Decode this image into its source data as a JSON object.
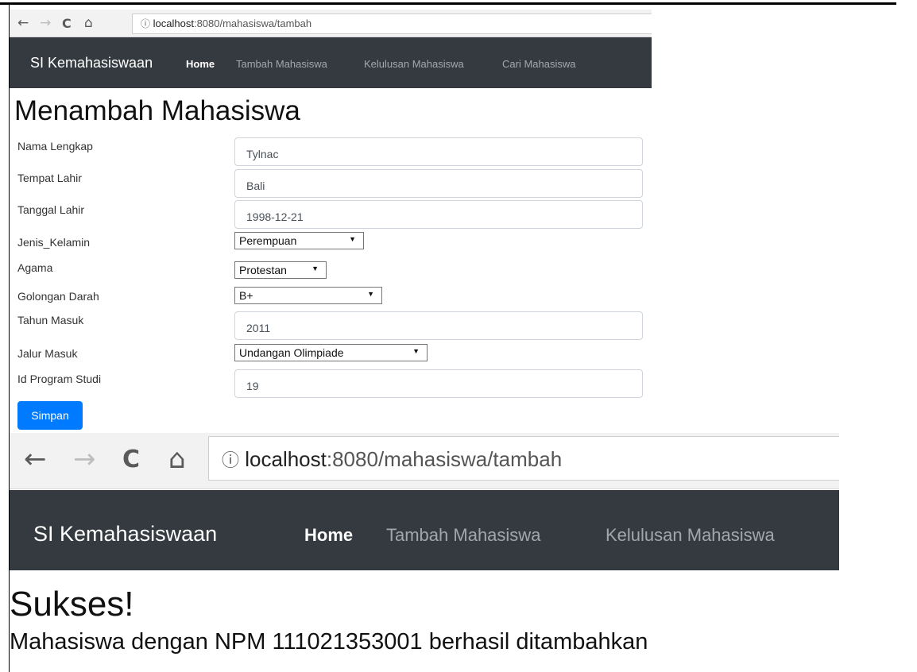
{
  "screen1": {
    "address": {
      "host": "localhost",
      "path": ":8080/mahasiswa/tambah"
    },
    "navbar": {
      "brand": "SI Kemahasiswaan",
      "links": [
        {
          "label": "Home",
          "active": true
        },
        {
          "label": "Tambah Mahasiswa",
          "active": false
        },
        {
          "label": "Kelulusan Mahasiswa",
          "active": false
        },
        {
          "label": "Cari Mahasiswa",
          "active": false
        }
      ]
    },
    "page_title": "Menambah Mahasiswa",
    "form": {
      "nama_label": "Nama Lengkap",
      "nama_value": "Tylnac",
      "tempat_label": "Tempat Lahir",
      "tempat_value": "Bali",
      "tanggal_label": "Tanggal Lahir",
      "tanggal_value": "1998-12-21",
      "jk_label": "Jenis_Kelamin",
      "jk_value": "Perempuan",
      "agama_label": "Agama",
      "agama_value": "Protestan",
      "gol_label": "Golongan Darah",
      "gol_value": "B+",
      "tahun_label": "Tahun Masuk",
      "tahun_value": "2011",
      "jalur_label": "Jalur Masuk",
      "jalur_value": "Undangan Olimpiade",
      "prodi_label": "Id Program Studi",
      "prodi_value": "19",
      "submit_label": "Simpan"
    }
  },
  "screen2": {
    "address": {
      "host": "localhost",
      "path": ":8080/mahasiswa/tambah"
    },
    "navbar": {
      "brand": "SI Kemahasiswaan",
      "links": [
        {
          "label": "Home",
          "active": true
        },
        {
          "label": "Tambah Mahasiswa",
          "active": false
        },
        {
          "label": "Kelulusan Mahasiswa",
          "active": false
        }
      ]
    },
    "heading": "Sukses!",
    "message": "Mahasiswa dengan NPM 111021353001 berhasil ditambahkan"
  },
  "icons": [
    "back-arrow-icon",
    "forward-arrow-icon",
    "reload-icon",
    "home-icon",
    "info-icon",
    "dropdown-arrow-icon"
  ]
}
